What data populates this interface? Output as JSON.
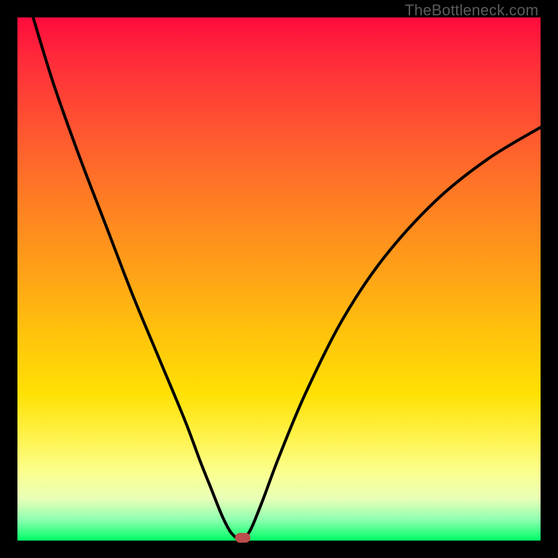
{
  "watermark": "TheBottleneck.com",
  "colors": {
    "curve_stroke": "#000000",
    "marker_fill": "#bb4d4d",
    "frame_bg": "#000000"
  },
  "chart_data": {
    "type": "line",
    "title": "",
    "xlabel": "",
    "ylabel": "",
    "xlim": [
      0,
      100
    ],
    "ylim": [
      0,
      100
    ],
    "series": [
      {
        "name": "curve",
        "x": [
          3,
          7,
          12,
          17,
          22,
          27,
          32,
          35,
          37,
          39,
          40.5,
          41.5,
          42,
          43,
          44,
          45,
          47,
          50,
          55,
          62,
          70,
          80,
          90,
          100
        ],
        "y": [
          100,
          87,
          73,
          60,
          47,
          35,
          23,
          15,
          10,
          5,
          2,
          0.8,
          0.5,
          0.5,
          1.2,
          3,
          8,
          16,
          28,
          42,
          54,
          65,
          73,
          79
        ]
      }
    ],
    "marker": {
      "x": 43,
      "y": 0.5
    },
    "gradient_stops": [
      {
        "pct": 0,
        "color": "#ff0b3d"
      },
      {
        "pct": 50,
        "color": "#ffa516"
      },
      {
        "pct": 80,
        "color": "#fff24a"
      },
      {
        "pct": 100,
        "color": "#00ff66"
      }
    ]
  }
}
